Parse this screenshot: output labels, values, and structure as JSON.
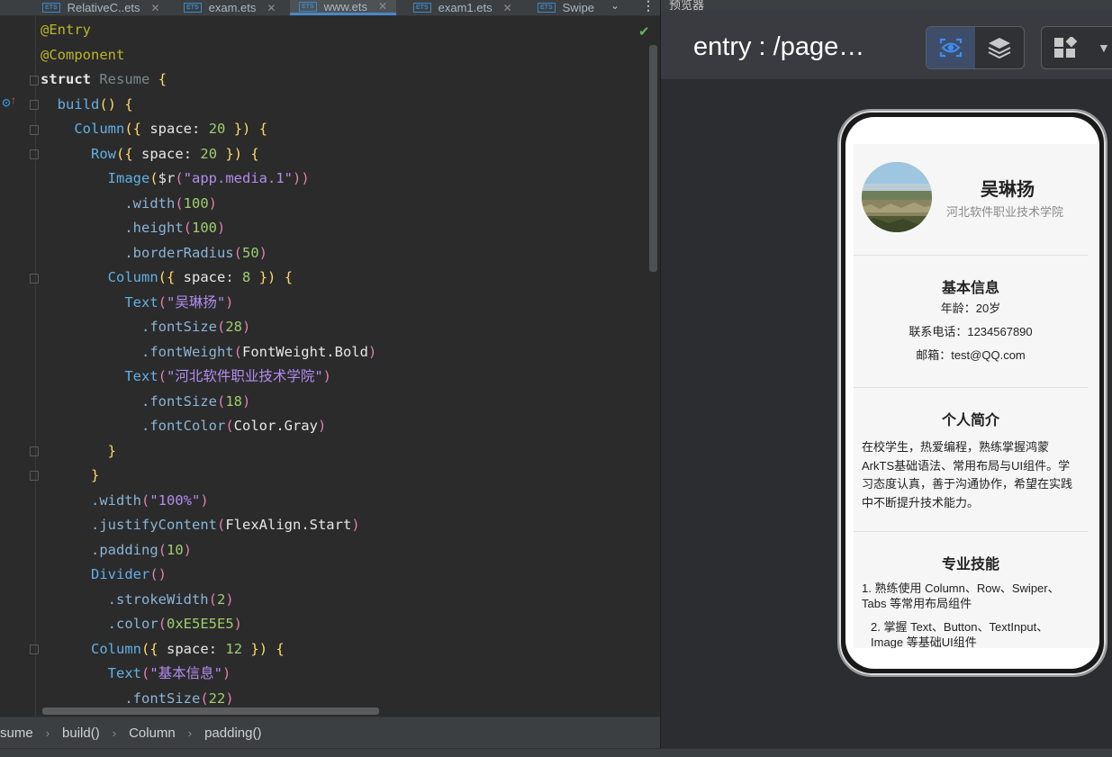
{
  "tabs": [
    {
      "label": "RelativeC..ets",
      "badge": "ETS"
    },
    {
      "label": "exam.ets",
      "badge": "ETS"
    },
    {
      "label": "www.ets",
      "badge": "ETS"
    },
    {
      "label": "exam1.ets",
      "badge": "ETS"
    },
    {
      "label": "Swipe",
      "badge": "ETS"
    }
  ],
  "code": {
    "l1": "@Entry",
    "l2": "@Component",
    "l3a": "struct",
    "l3b": "Resume",
    "l4": "build",
    "l5a": "Column",
    "l5b": "space",
    "l5c": "20",
    "l6a": "Row",
    "l6b": "space",
    "l6c": "20",
    "l7a": "Image",
    "l7b": "$r",
    "l7c": "\"app.media.1\"",
    "l8a": ".width",
    "l8b": "100",
    "l9a": ".height",
    "l9b": "100",
    "l10a": ".borderRadius",
    "l10b": "50",
    "l11a": "Column",
    "l11b": "space",
    "l11c": "8",
    "l12a": "Text",
    "l12b": "\"吴琳扬\"",
    "l13a": ".fontSize",
    "l13b": "28",
    "l14a": ".fontWeight",
    "l14b": "FontWeight.Bold",
    "l15a": "Text",
    "l15b": "\"河北软件职业技术学院\"",
    "l16a": ".fontSize",
    "l16b": "18",
    "l17a": ".fontColor",
    "l17b": "Color.Gray",
    "l20a": ".width",
    "l20b": "\"100%\"",
    "l21a": ".justifyContent",
    "l21b": "FlexAlign.Start",
    "l22a": ".padding",
    "l22b": "10",
    "l23a": "Divider",
    "l24a": ".strokeWidth",
    "l24b": "2",
    "l25a": ".color",
    "l25b": "0xE5E5E5",
    "l26a": "Column",
    "l26b": "space",
    "l26c": "12",
    "l27a": "Text",
    "l27b": "\"基本信息\"",
    "l28a": ".fontSize",
    "l28b": "22"
  },
  "breadcrumb": [
    "sume",
    "build()",
    "Column",
    "padding()"
  ],
  "previewer": {
    "panel_label": "预览器",
    "title": "entry : /page…"
  },
  "app": {
    "name": "吴琳扬",
    "school": "河北软件职业技术学院",
    "basic_title": "基本信息",
    "age": "年龄：20岁",
    "phone": "联系电话：1234567890",
    "email": "邮箱：test@QQ.com",
    "intro_title": "个人简介",
    "intro_text": "在校学生，热爱编程，熟练掌握鸿蒙ArkTS基础语法、常用布局与UI组件。学习态度认真，善于沟通协作，希望在实践中不断提升技术能力。",
    "skills_title": "专业技能",
    "skill1": "1. 熟练使用 Column、Row、Swiper、Tabs 等常用布局组件",
    "skill2": "2. 掌握 Text、Button、TextInput、Image 等基础UI组件"
  },
  "colors": {
    "accent": "#3d86c6",
    "check": "#5fb85c"
  }
}
